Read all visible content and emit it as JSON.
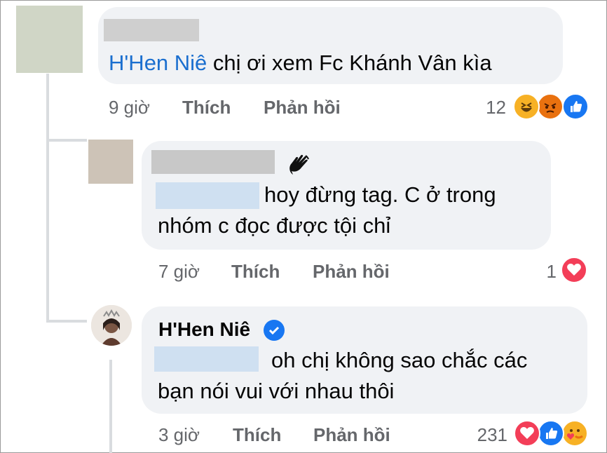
{
  "comments": [
    {
      "mention": "H'Hen Niê",
      "text": " chị ơi xem Fc Khánh Vân kìa",
      "time": "9 giờ",
      "like_label": "Thích",
      "reply_label": "Phản hồi",
      "reaction_count": "12",
      "reactions": [
        "haha-icon",
        "angry-icon",
        "like-icon"
      ]
    },
    {
      "text_line1": "hoy đừng tag. C ở trong",
      "text_line2": "nhóm c đọc được tội chỉ",
      "time": "7 giờ",
      "like_label": "Thích",
      "reply_label": "Phản hồi",
      "reaction_count": "1",
      "reactions": [
        "love-icon"
      ]
    },
    {
      "author": "H'Hen Niê",
      "text_line1": "oh chị không sao chắc các",
      "text_line2": "bạn nói vui với nhau thôi",
      "time": "3 giờ",
      "like_label": "Thích",
      "reply_label": "Phản hồi",
      "reaction_count": "231",
      "reactions": [
        "love-icon",
        "like-icon",
        "care-icon"
      ]
    }
  ],
  "colors": {
    "bubble": "#f0f2f5",
    "mention_link": "#1b6fcf",
    "redaction_gray": "#c8c8c8",
    "redaction_blue": "#cfe0f1",
    "verified": "#1877f2"
  }
}
